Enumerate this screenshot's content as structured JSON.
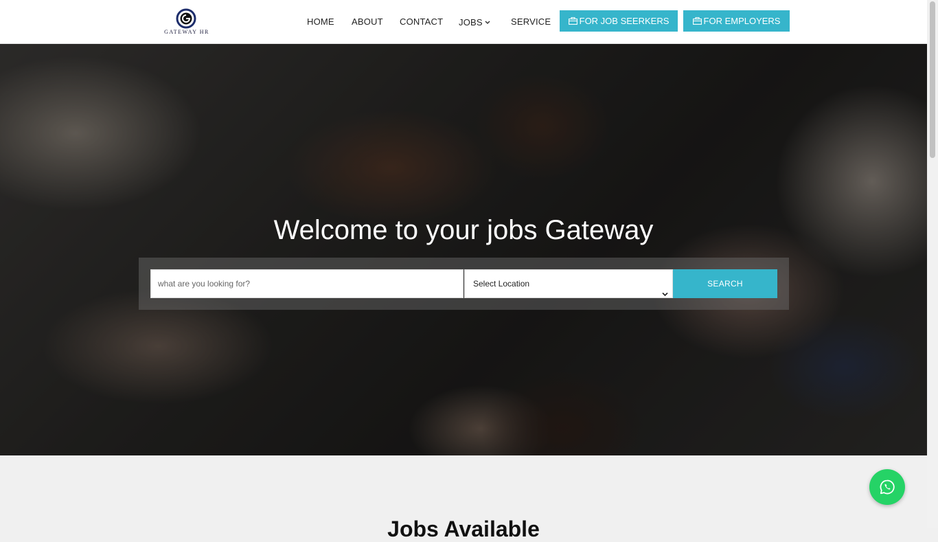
{
  "header": {
    "logo_text": "GATEWAY HR",
    "nav": {
      "home": "HOME",
      "about": "ABOUT",
      "contact": "CONTACT",
      "jobs": "JOBS",
      "service": "SERVICE"
    },
    "cta_job_seekers": "FOR JOB SEERKERS",
    "cta_employers": "FOR EMPLOYERS"
  },
  "hero": {
    "title": "Welcome to your jobs Gateway",
    "search": {
      "placeholder": "what are you looking for?",
      "value": "",
      "location_selected": "Select Location",
      "button": "SEARCH"
    }
  },
  "jobs_section": {
    "heading": "Jobs Available"
  },
  "icons": {
    "logo": "gateway-g-logo",
    "nav_dropdown": "chevron-down-icon",
    "cta": "briefcase-icon",
    "floating": "whatsapp-icon"
  },
  "colors": {
    "accent": "#36b5cb",
    "whatsapp": "#25d366",
    "logo_blue": "#1d2d6b"
  }
}
